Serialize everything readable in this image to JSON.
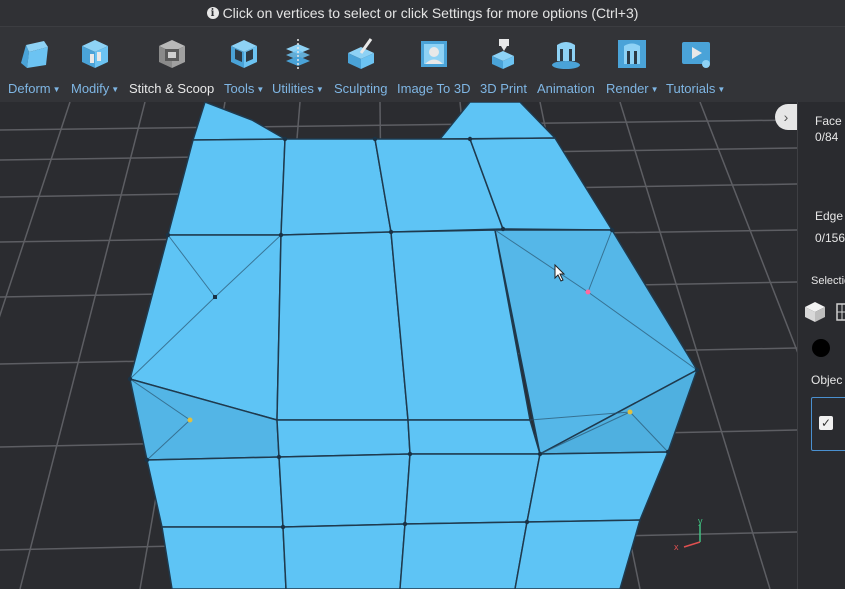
{
  "hint": {
    "icon": "info-icon",
    "text": "Click on vertices to select or click Settings for more options (Ctrl+3)"
  },
  "toolbar": [
    {
      "label": "Deform",
      "dropdown": true,
      "icon": "deform-cube-icon"
    },
    {
      "label": "Modify",
      "dropdown": true,
      "icon": "modify-cube-icon"
    },
    {
      "label": "Stitch & Scoop",
      "dropdown": false,
      "icon": "stitch-scoop-icon"
    },
    {
      "label": "Tools",
      "dropdown": true,
      "icon": "tools-icon"
    },
    {
      "label": "Utilities",
      "dropdown": true,
      "icon": "utilities-icon"
    },
    {
      "label": "Sculpting",
      "dropdown": false,
      "icon": "sculpting-icon"
    },
    {
      "label": "Image To 3D",
      "dropdown": false,
      "icon": "image-to-3d-icon"
    },
    {
      "label": "3D Print",
      "dropdown": false,
      "icon": "3d-print-icon"
    },
    {
      "label": "Animation",
      "dropdown": false,
      "icon": "animation-icon"
    },
    {
      "label": "Render",
      "dropdown": true,
      "icon": "render-icon"
    },
    {
      "label": "Tutorials",
      "dropdown": true,
      "icon": "tutorials-icon"
    }
  ],
  "panel": {
    "face_label": "Face",
    "face_count": "0/84",
    "edge_label": "Edge",
    "edge_count": "0/156",
    "selection_label": "Selectio",
    "objects_label": "Objec"
  },
  "axis": {
    "x": "x",
    "y": "y"
  },
  "colors": {
    "mesh": "#5ec4f5",
    "accent": "#7fb6e4",
    "background": "#2b2c30"
  }
}
